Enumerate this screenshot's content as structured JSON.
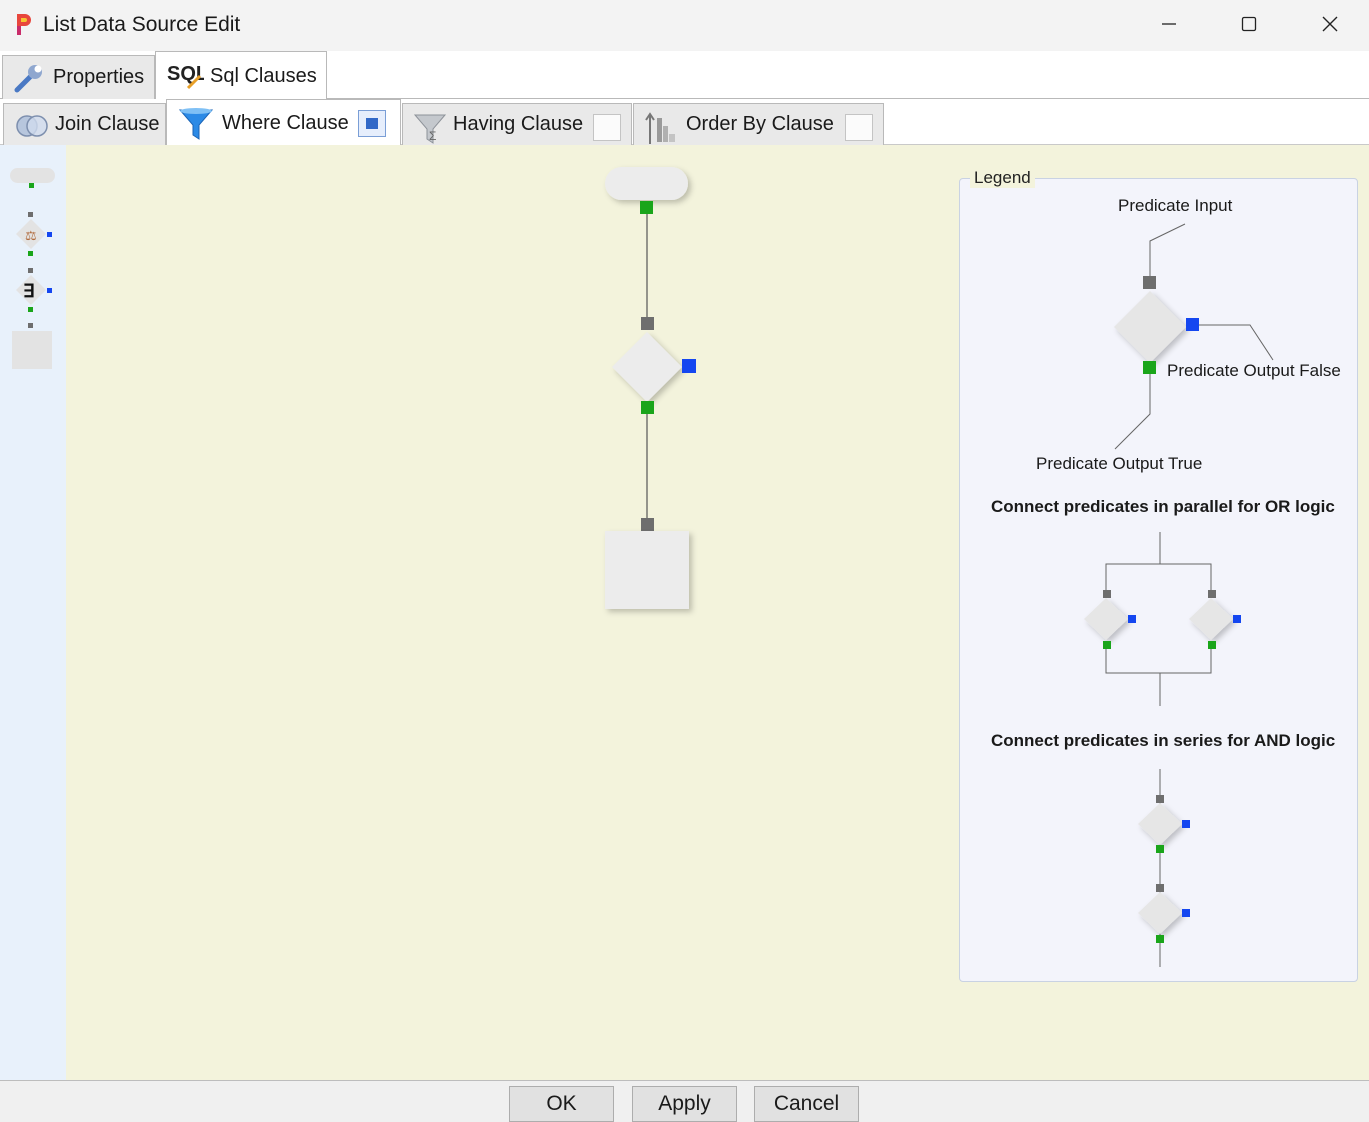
{
  "window": {
    "title": "List Data Source Edit"
  },
  "top_tabs": [
    {
      "label": "Properties",
      "icon": "wrench-icon",
      "active": false
    },
    {
      "label": "Sql Clauses",
      "icon": "sql-icon",
      "active": true
    }
  ],
  "clause_tabs": [
    {
      "label": "Join Clause",
      "icon": "join-icon",
      "active": false
    },
    {
      "label": "Where Clause",
      "icon": "funnel-icon",
      "active": true,
      "checked": true
    },
    {
      "label": "Having Clause",
      "icon": "having-funnel-icon",
      "active": false,
      "checked": false
    },
    {
      "label": "Order By Clause",
      "icon": "sort-icon",
      "active": false,
      "checked": false
    }
  ],
  "toolbox": {
    "items": [
      "start-node",
      "condition-node",
      "exists-node",
      "end-node"
    ]
  },
  "legend": {
    "title": "Legend",
    "predicate_input": "Predicate Input",
    "predicate_output_false": "Predicate Output False",
    "predicate_output_true": "Predicate Output True",
    "or_text": "Connect predicates in parallel for OR logic",
    "and_text": "Connect predicates in series for AND logic"
  },
  "buttons": {
    "ok": "OK",
    "apply": "Apply",
    "cancel": "Cancel"
  },
  "colors": {
    "canvas": "#f3f3dc",
    "toolbox": "#e8f1fb",
    "true_port": "#1aa51a",
    "false_port": "#1446f0",
    "input_port": "#6e6e6e"
  }
}
